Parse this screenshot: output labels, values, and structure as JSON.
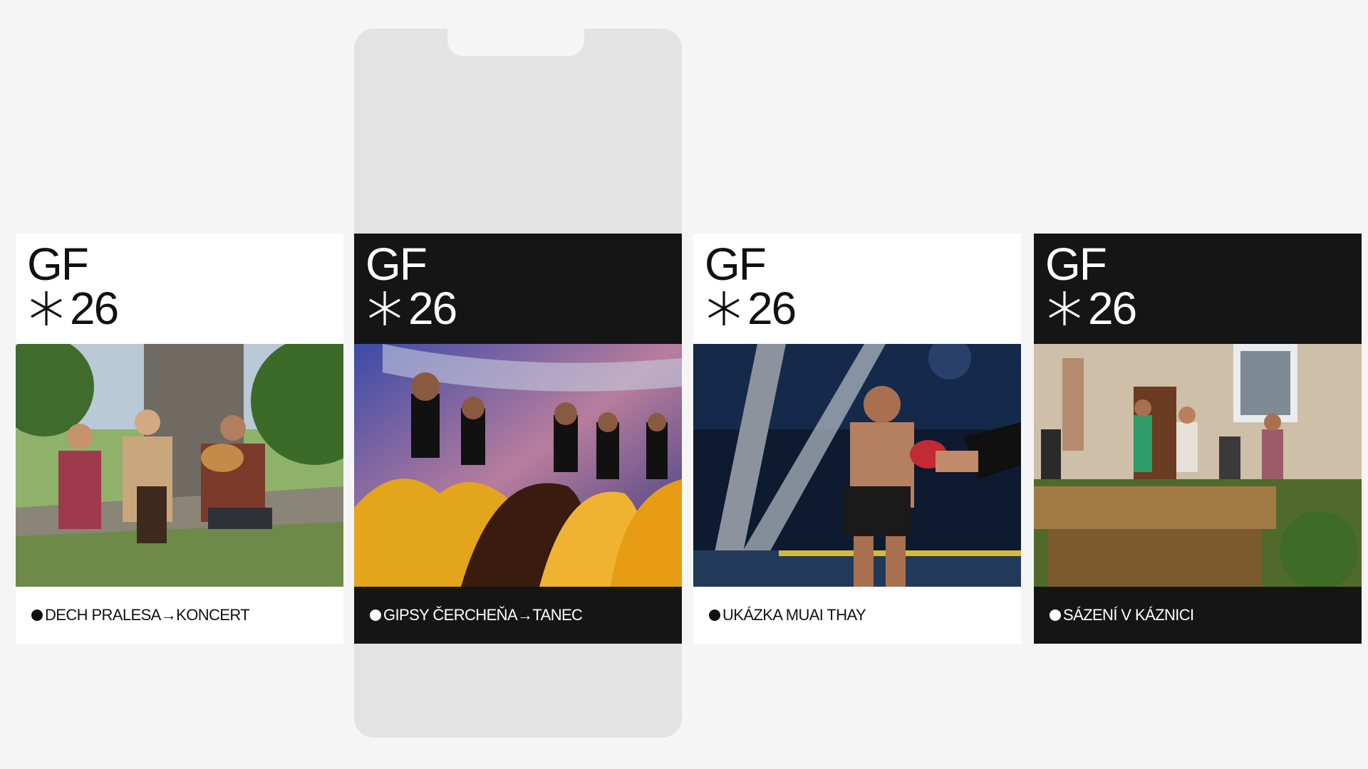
{
  "phone_frame": {
    "label": "phone preview frame"
  },
  "cards": [
    {
      "theme": "light",
      "logo_top": "GF",
      "logo_number": "26",
      "caption": "DECH PRALESA→KONCERT",
      "photo_icon": "musicians-photo",
      "accent": "#ffffff"
    },
    {
      "theme": "dark",
      "logo_top": "GF",
      "logo_number": "26",
      "caption": "GIPSY ČERCHEŇA→TANEC",
      "photo_icon": "dancers-photo",
      "accent": "#151515"
    },
    {
      "theme": "light",
      "logo_top": "GF",
      "logo_number": "26",
      "caption": "UKÁZKA MUAI THAY",
      "photo_icon": "boxing-photo",
      "accent": "#ffffff"
    },
    {
      "theme": "dark",
      "logo_top": "GF",
      "logo_number": "26",
      "caption": "SÁZENÍ V KÁZNICI",
      "photo_icon": "gardening-photo",
      "accent": "#151515"
    }
  ],
  "colors": {
    "background": "#f5f5f5",
    "frame": "#e3e3e3",
    "dark_card": "#151515",
    "light_card": "#ffffff"
  }
}
